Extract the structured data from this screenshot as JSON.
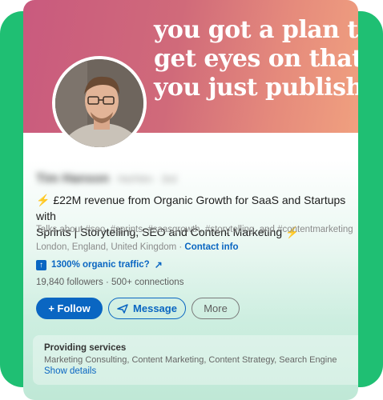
{
  "banner": {
    "lines": [
      "you got a plan to",
      "get eyes on that",
      "you just publish"
    ]
  },
  "profile": {
    "name": "Tim Hanson",
    "name_suffix": "He/Him · 3rd",
    "headline_part1": "£22M revenue from Organic Growth for SaaS and Startups with",
    "headline_part2": "Sprints | Storytelling, SEO and Content Marketing",
    "talks_about": "Talks about #seo, #sprints, #saasgrowth, #storytelling, and #contentmarketing",
    "location": "London, England, United Kingdom",
    "contact_info": "Contact info",
    "traffic_link": "1300% organic traffic?",
    "followers": "19,840 followers",
    "connections": "500+ connections"
  },
  "actions": {
    "follow": "+ Follow",
    "message": "Message",
    "more": "More"
  },
  "services": {
    "title": "Providing services",
    "list": "Marketing Consulting, Content Marketing, Content Strategy, Search Engine",
    "show_details": "Show details"
  },
  "colors": {
    "accent": "#0a66c2",
    "frame_green": "#1fbf73",
    "bolt": "#f29a2c"
  }
}
